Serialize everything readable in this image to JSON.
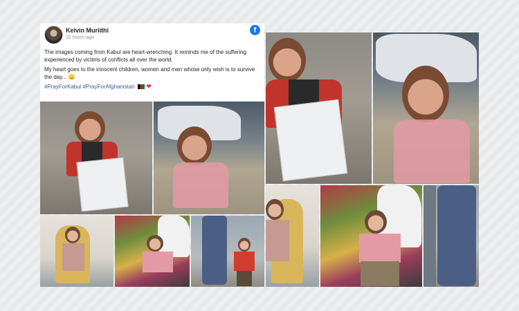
{
  "post": {
    "author": "Kelvin Muriithi",
    "timestamp": "15 hours ago",
    "paragraph1": "The images coming from Kabul are heart-wrenching. It reminds me of the suffering experienced by victims of conflicts all over the world.",
    "paragraph2": "My heart goes to the innocent children, women and men whose only wish is to survive the day... 😞",
    "hashtags": "#PrayForKabul #PrayForAfghanistan",
    "heart": "❤",
    "facebook_glyph": "f"
  },
  "colors": {
    "facebook_blue": "#1877f2",
    "hashtag_blue": "#385898",
    "background": "#e9eaeb"
  },
  "icons": {
    "platform": "facebook-icon",
    "flag": "afghanistan-flag-icon",
    "heart": "red-heart-icon"
  }
}
